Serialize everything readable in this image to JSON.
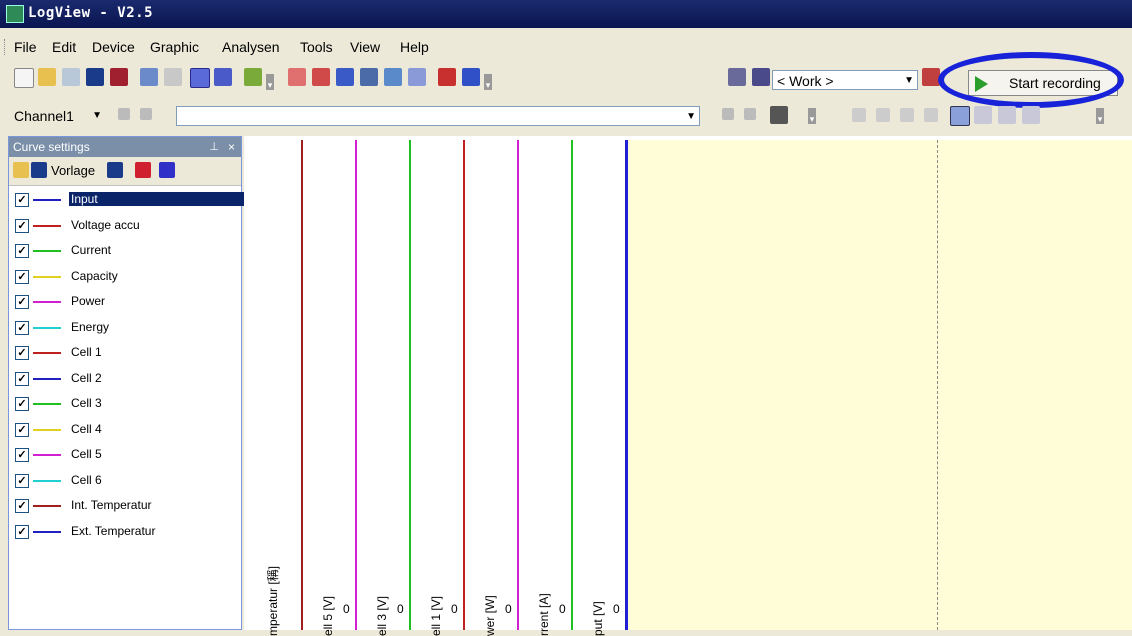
{
  "window": {
    "title": "LogView - V2.5"
  },
  "menu": [
    "File",
    "Edit",
    "Device",
    "Graphic",
    "Analysen",
    "Tools",
    "View",
    "Help"
  ],
  "toolbar": {
    "work_combo": "< Work >",
    "record_label": "Start recording"
  },
  "channel_toolbar": {
    "channel": "Channel1"
  },
  "panel": {
    "title": "Curve settings",
    "pin": "2",
    "close": "×",
    "vorlage": "Vorlage",
    "curves": [
      {
        "name": "Input",
        "color": "#2020c0",
        "checked": true,
        "selected": true
      },
      {
        "name": "Voltage accu",
        "color": "#c02020",
        "checked": true
      },
      {
        "name": "Current",
        "color": "#20c020",
        "checked": true
      },
      {
        "name": "Capacity",
        "color": "#e0d020",
        "checked": true
      },
      {
        "name": "Power",
        "color": "#d020d0",
        "checked": true
      },
      {
        "name": "Energy",
        "color": "#20d0d0",
        "checked": true
      },
      {
        "name": "Cell 1",
        "color": "#c02020",
        "checked": true
      },
      {
        "name": "Cell 2",
        "color": "#2020c0",
        "checked": true
      },
      {
        "name": "Cell 3",
        "color": "#20c020",
        "checked": true
      },
      {
        "name": "Cell 4",
        "color": "#e0d020",
        "checked": true
      },
      {
        "name": "Cell 5",
        "color": "#d020d0",
        "checked": true
      },
      {
        "name": "Cell 6",
        "color": "#20d0d0",
        "checked": true
      },
      {
        "name": "Int. Temperatur",
        "color": "#a02020",
        "checked": true
      },
      {
        "name": "Ext. Temperatur",
        "color": "#2020c0",
        "checked": true
      }
    ]
  },
  "axes": [
    {
      "label": "mperatur [稱]",
      "color": "#a02020"
    },
    {
      "label": "ell 5 [V]",
      "color": "#d020d0",
      "zero": "0"
    },
    {
      "label": "ell 3 [V]",
      "color": "#20c020",
      "zero": "0"
    },
    {
      "label": "ell 1 [V]",
      "color": "#c02020",
      "zero": "0"
    },
    {
      "label": "wer [W]",
      "color": "#d020d0",
      "zero": "0"
    },
    {
      "label": "rrent [A]",
      "color": "#20c020",
      "zero": "0"
    },
    {
      "label": "put [V]",
      "color": "#2020c0",
      "zero": "0"
    }
  ]
}
